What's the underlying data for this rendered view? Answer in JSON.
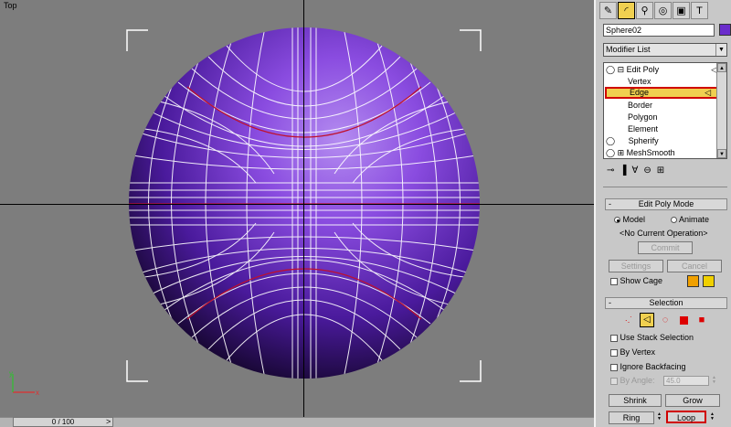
{
  "viewport": {
    "label": "Top"
  },
  "timeslider": {
    "value": "0 / 100",
    "next": ">"
  },
  "panel": {
    "object_name": "Sphere02",
    "object_color": "#6a2ccc",
    "modifier_list": "Modifier List",
    "stack": [
      {
        "label": "Edit Poly",
        "type": "modifier"
      },
      {
        "label": "Vertex",
        "type": "sub"
      },
      {
        "label": "Edge",
        "type": "sub",
        "selected": true
      },
      {
        "label": "Border",
        "type": "sub"
      },
      {
        "label": "Polygon",
        "type": "sub"
      },
      {
        "label": "Element",
        "type": "sub"
      },
      {
        "label": "Spherify",
        "type": "modifier"
      },
      {
        "label": "MeshSmooth",
        "type": "modifier"
      }
    ],
    "edit_poly_mode": {
      "title": "Edit Poly Mode",
      "sign": "-",
      "model": "Model",
      "animate": "Animate",
      "operation": "<No Current Operation>",
      "commit": "Commit",
      "settings": "Settings",
      "cancel": "Cancel",
      "show_cage": "Show Cage",
      "cage_colors": [
        "#f0a000",
        "#f0d000"
      ]
    },
    "selection": {
      "title": "Selection",
      "sign": "-",
      "use_stack": "Use Stack Selection",
      "by_vertex": "By Vertex",
      "ignore_backfacing": "Ignore Backfacing",
      "by_angle": "By Angle:",
      "angle_value": "45.0",
      "shrink": "Shrink",
      "grow": "Grow",
      "ring": "Ring",
      "loop": "Loop"
    }
  }
}
